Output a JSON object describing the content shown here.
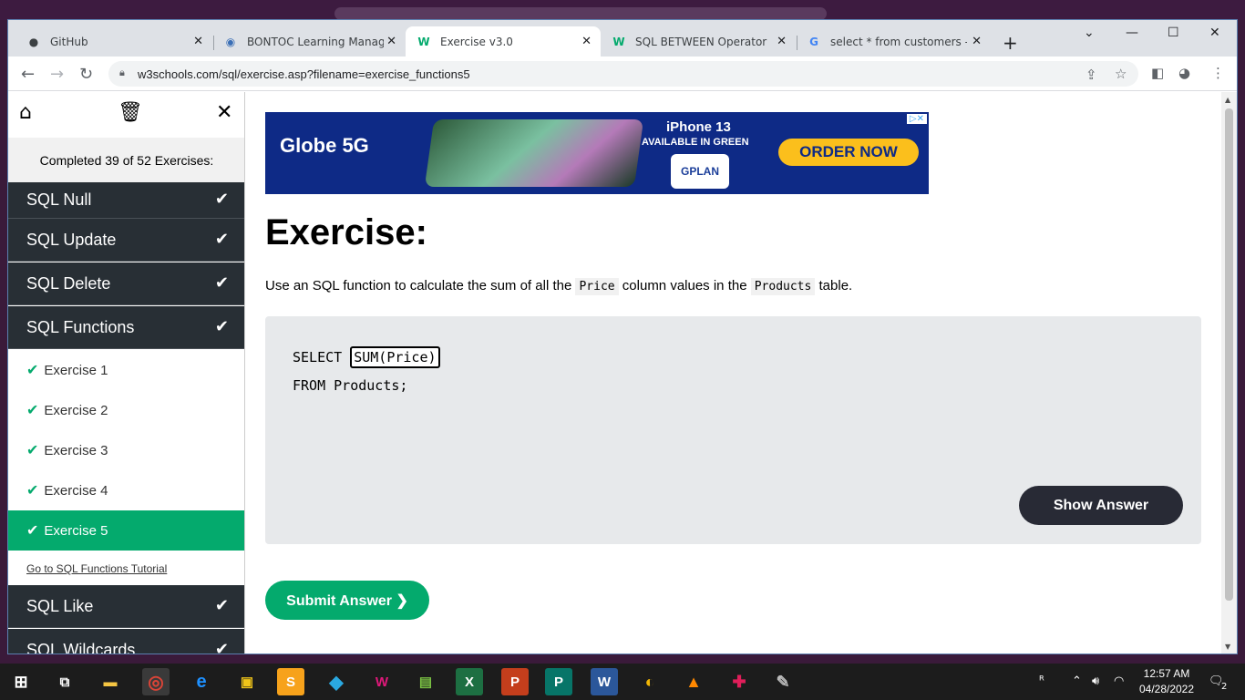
{
  "browser": {
    "tabs": [
      {
        "title": "GitHub",
        "icon": "github-icon"
      },
      {
        "title": "BONTOC Learning Managem",
        "icon": "lms-icon"
      },
      {
        "title": "Exercise v3.0",
        "icon": "w3schools-icon",
        "active": true
      },
      {
        "title": "SQL BETWEEN Operator",
        "icon": "w3schools-icon"
      },
      {
        "title": "select * from customers - Go",
        "icon": "google-icon"
      }
    ],
    "url": "w3schools.com/sql/exercise.asp?filename=exercise_functions5"
  },
  "sidebar": {
    "completed_text": "Completed 39 of 52 Exercises:",
    "chapters_top": [
      {
        "label": "SQL Null"
      },
      {
        "label": "SQL Update"
      },
      {
        "label": "SQL Delete"
      },
      {
        "label": "SQL Functions"
      }
    ],
    "exercises": [
      {
        "label": "Exercise 1"
      },
      {
        "label": "Exercise 2"
      },
      {
        "label": "Exercise 3"
      },
      {
        "label": "Exercise 4"
      },
      {
        "label": "Exercise 5",
        "current": true
      }
    ],
    "tutorial_link": "Go to SQL Functions Tutorial",
    "chapters_bottom": [
      {
        "label": "SQL Like"
      },
      {
        "label": "SQL Wildcards"
      }
    ]
  },
  "ad": {
    "brand": "Globe 5G",
    "product": "iPhone 13",
    "subtitle": "AVAILABLE IN GREEN",
    "plan": "GPLAN",
    "cta": "ORDER NOW"
  },
  "exercise": {
    "heading": "Exercise:",
    "instr_pre": "Use an SQL function to calculate the sum of all the",
    "instr_code1": "Price",
    "instr_mid": "column values in the",
    "instr_code2": "Products",
    "instr_post": "table.",
    "code_line1_prefix": "SELECT",
    "answer_value": "SUM(Price)",
    "code_line2": "FROM Products;",
    "show_answer": "Show Answer",
    "submit": "Submit Answer ❯"
  },
  "taskbar": {
    "time": "12:57 AM",
    "date": "04/28/2022",
    "notifications": "2"
  },
  "colors": {
    "accent_green": "#04aa6d",
    "sidebar_dark": "#282f35",
    "button_dark": "#282a35",
    "code_bg": "#e7e9eb"
  }
}
